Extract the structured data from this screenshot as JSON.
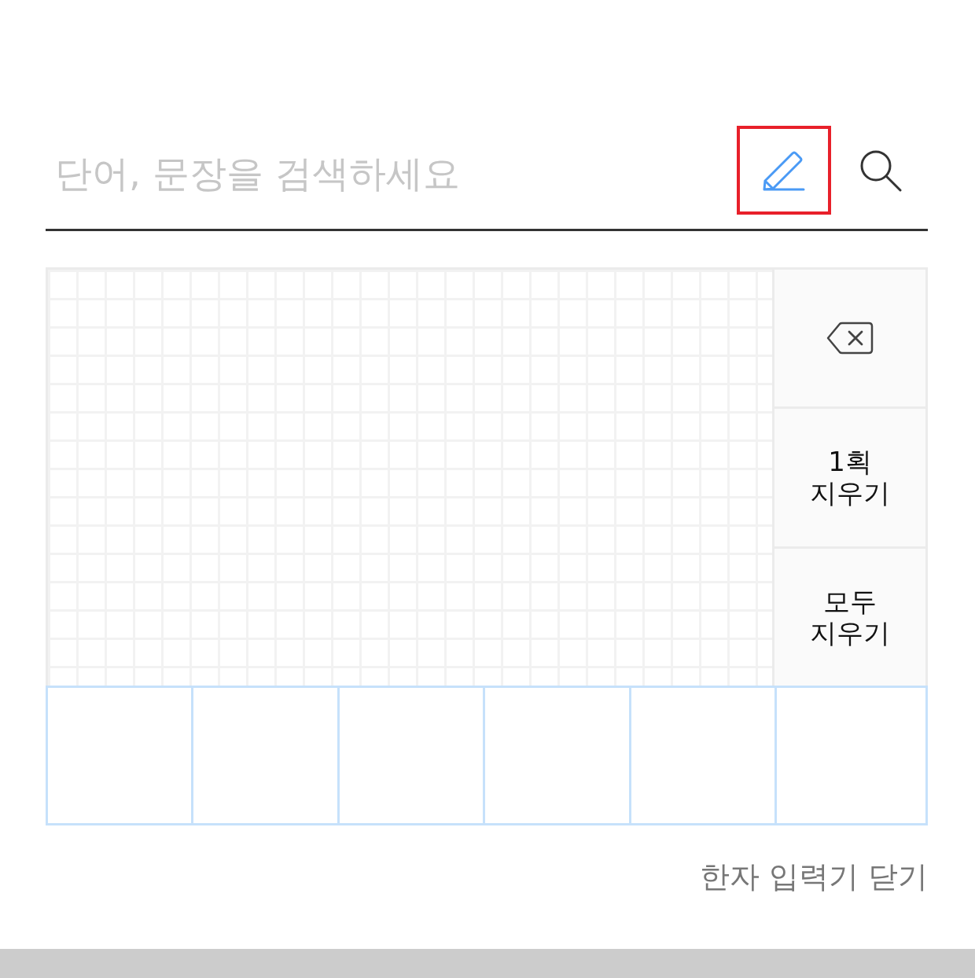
{
  "search": {
    "placeholder": "단어, 문장을 검색하세요"
  },
  "toolbar": {
    "handwriting_button": {
      "active": true,
      "highlighted": true
    }
  },
  "handwriting_pad": {
    "side_buttons": [
      {
        "kind": "backspace"
      },
      {
        "kind": "text",
        "label": "1획 지우기"
      },
      {
        "kind": "text",
        "label": "모두 지우기"
      }
    ]
  },
  "close_link": "한자 입력기 닫기"
}
